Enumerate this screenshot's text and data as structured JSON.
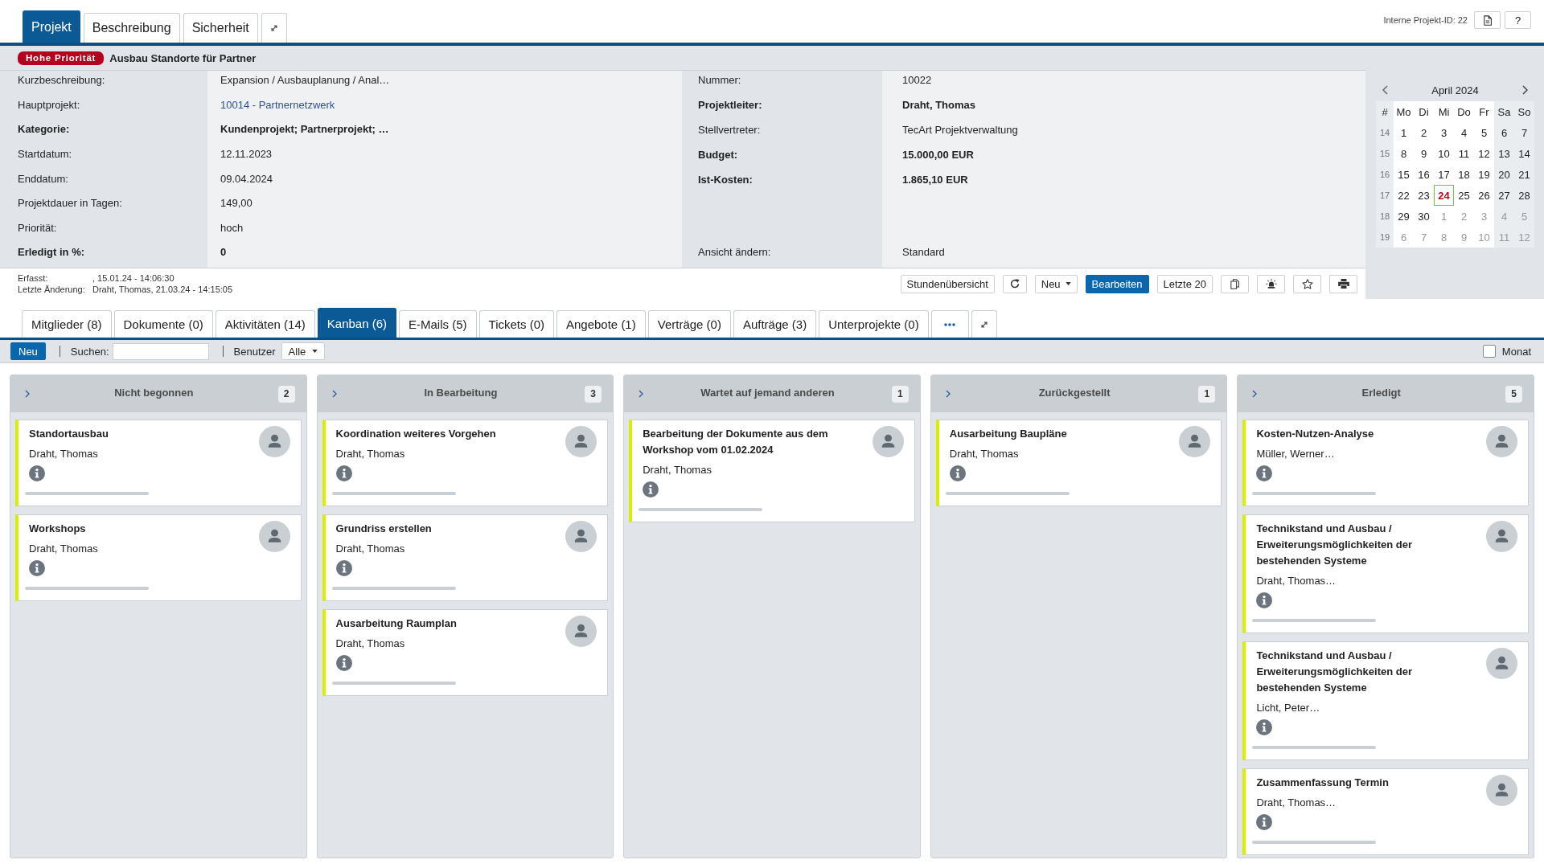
{
  "top_tabs": [
    {
      "label": "Projekt",
      "selected": true
    },
    {
      "label": "Beschreibung",
      "selected": false
    },
    {
      "label": "Sicherheit",
      "selected": false
    }
  ],
  "header": {
    "project_id": "Interne Projekt-ID: 22",
    "help_button": "?"
  },
  "project": {
    "priority": "Hohe Priorität",
    "title": "Ausbau Standorte für Partner"
  },
  "details_left": [
    {
      "kind": "text",
      "label": "Kurzbeschreibung:",
      "value": "Expansion / Ausbauplanung / Anal…",
      "bold": false
    },
    {
      "kind": "link",
      "label": "Hauptprojekt:",
      "value": "10014 - Partnernetzwerk",
      "bold": false
    },
    {
      "kind": "text",
      "label": "Kategorie:",
      "value": "Kundenprojekt; Partnerprojekt; …",
      "bold": true
    },
    {
      "kind": "text",
      "label": "Startdatum:",
      "value": "12.11.2023",
      "bold": false
    },
    {
      "kind": "text",
      "label": "Enddatum:",
      "value": "09.04.2024",
      "bold": false
    },
    {
      "kind": "text",
      "label": "Projektdauer in Tagen:",
      "value": "149,00",
      "bold": false
    },
    {
      "kind": "text",
      "label": "Priorität:",
      "value": "hoch",
      "bold": false
    },
    {
      "kind": "text",
      "label": "Erledigt in %:",
      "value": "0",
      "bold": true
    }
  ],
  "details_right": [
    {
      "label": "Nummer:",
      "value": "10022",
      "bold": false
    },
    {
      "label": "Projektleiter:",
      "value": "Draht, Thomas",
      "bold": true
    },
    {
      "label": "Stellvertreter:",
      "value": "TecArt Projektverwaltung",
      "bold": false
    },
    {
      "label": "Budget:",
      "value": "15.000,00 EUR",
      "bold": true
    },
    {
      "label": "Ist-Kosten:",
      "value": "1.865,10 EUR",
      "bold": true
    }
  ],
  "view_setting": {
    "label": "Ansicht ändern:",
    "value": "Standard"
  },
  "record_info": {
    "created_label": "Erfasst:",
    "created_value": ", 15.01.24 - 14:06:30",
    "changed_label": "Letzte Änderung:",
    "changed_value": "Draht, Thomas, 21.03.24 - 14:15:05"
  },
  "actions": {
    "hours_button": "Stundenübersicht",
    "new_menu": "Neu",
    "edit_button": "Bearbeiten",
    "recent_button": "Letzte 20"
  },
  "calendar": {
    "month": "April 2024",
    "week_header": "#",
    "weekdays": [
      "Mo",
      "Di",
      "Mi",
      "Do",
      "Fr",
      "Sa",
      "So"
    ],
    "weeks": [
      {
        "number": "14",
        "days": [
          {
            "day": "1",
            "outside": false,
            "today": false
          },
          {
            "day": "2",
            "outside": false,
            "today": false
          },
          {
            "day": "3",
            "outside": false,
            "today": false
          },
          {
            "day": "4",
            "outside": false,
            "today": false
          },
          {
            "day": "5",
            "outside": false,
            "today": false
          },
          {
            "day": "6",
            "outside": false,
            "today": false
          },
          {
            "day": "7",
            "outside": false,
            "today": false
          }
        ]
      },
      {
        "number": "15",
        "days": [
          {
            "day": "8",
            "outside": false,
            "today": false
          },
          {
            "day": "9",
            "outside": false,
            "today": false
          },
          {
            "day": "10",
            "outside": false,
            "today": false
          },
          {
            "day": "11",
            "outside": false,
            "today": false
          },
          {
            "day": "12",
            "outside": false,
            "today": false
          },
          {
            "day": "13",
            "outside": false,
            "today": false
          },
          {
            "day": "14",
            "outside": false,
            "today": false
          }
        ]
      },
      {
        "number": "16",
        "days": [
          {
            "day": "15",
            "outside": false,
            "today": false
          },
          {
            "day": "16",
            "outside": false,
            "today": false
          },
          {
            "day": "17",
            "outside": false,
            "today": false
          },
          {
            "day": "18",
            "outside": false,
            "today": false
          },
          {
            "day": "19",
            "outside": false,
            "today": false
          },
          {
            "day": "20",
            "outside": false,
            "today": false
          },
          {
            "day": "21",
            "outside": false,
            "today": false
          }
        ]
      },
      {
        "number": "17",
        "days": [
          {
            "day": "22",
            "outside": false,
            "today": false
          },
          {
            "day": "23",
            "outside": false,
            "today": false
          },
          {
            "day": "24",
            "outside": false,
            "today": true
          },
          {
            "day": "25",
            "outside": false,
            "today": false
          },
          {
            "day": "26",
            "outside": false,
            "today": false
          },
          {
            "day": "27",
            "outside": false,
            "today": false
          },
          {
            "day": "28",
            "outside": false,
            "today": false
          }
        ]
      },
      {
        "number": "18",
        "days": [
          {
            "day": "29",
            "outside": false,
            "today": false
          },
          {
            "day": "30",
            "outside": false,
            "today": false
          },
          {
            "day": "1",
            "outside": true,
            "today": false
          },
          {
            "day": "2",
            "outside": true,
            "today": false
          },
          {
            "day": "3",
            "outside": true,
            "today": false
          },
          {
            "day": "4",
            "outside": true,
            "today": false
          },
          {
            "day": "5",
            "outside": true,
            "today": false
          }
        ]
      },
      {
        "number": "19",
        "days": [
          {
            "day": "6",
            "outside": true,
            "today": false
          },
          {
            "day": "7",
            "outside": true,
            "today": false
          },
          {
            "day": "8",
            "outside": true,
            "today": false
          },
          {
            "day": "9",
            "outside": true,
            "today": false
          },
          {
            "day": "10",
            "outside": true,
            "today": false
          },
          {
            "day": "11",
            "outside": true,
            "today": false
          },
          {
            "day": "12",
            "outside": true,
            "today": false
          }
        ]
      }
    ]
  },
  "detail_tabs": [
    {
      "label": "Mitglieder (8)",
      "selected": false
    },
    {
      "label": "Dokumente (0)",
      "selected": false
    },
    {
      "label": "Aktivitäten (14)",
      "selected": false
    },
    {
      "label": "Kanban (6)",
      "selected": true
    },
    {
      "label": "E-Mails (5)",
      "selected": false
    },
    {
      "label": "Tickets (0)",
      "selected": false
    },
    {
      "label": "Angebote (1)",
      "selected": false
    },
    {
      "label": "Verträge (0)",
      "selected": false
    },
    {
      "label": "Aufträge (3)",
      "selected": false
    },
    {
      "label": "Unterprojekte (0)",
      "selected": false
    }
  ],
  "toolbar": {
    "new_button": "Neu",
    "search_label": "Suchen:",
    "user_label": "Benutzer",
    "user_filter": "Alle",
    "month_label": "Monat",
    "month_checked": false
  },
  "kanban": {
    "columns": [
      {
        "title": "Nicht begonnen",
        "count": "2",
        "cards": [
          {
            "title": "Standortausbau",
            "assignee": "Draht, Thomas"
          },
          {
            "title": "Workshops",
            "assignee": "Draht, Thomas"
          }
        ]
      },
      {
        "title": "In Bearbeitung",
        "count": "3",
        "cards": [
          {
            "title": "Koordination weiteres Vorgehen",
            "assignee": "Draht, Thomas"
          },
          {
            "title": "Grundriss erstellen",
            "assignee": "Draht, Thomas"
          },
          {
            "title": "Ausarbeitung Raumplan",
            "assignee": "Draht, Thomas"
          }
        ]
      },
      {
        "title": "Wartet auf jemand anderen",
        "count": "1",
        "cards": [
          {
            "title": "Bearbeitung der Dokumente aus dem Workshop vom 01.02.2024",
            "assignee": "Draht, Thomas"
          }
        ]
      },
      {
        "title": "Zurückgestellt",
        "count": "1",
        "cards": [
          {
            "title": "Ausarbeitung Baupläne",
            "assignee": "Draht, Thomas"
          }
        ]
      },
      {
        "title": "Erledigt",
        "count": "5",
        "cards": [
          {
            "title": "Kosten-Nutzen-Analyse",
            "assignee": "Müller, Werner…"
          },
          {
            "title": "Technikstand und Ausbau / Erweiterungsmöglichkeiten der bestehenden Systeme",
            "assignee": "Draht, Thomas…"
          },
          {
            "title": "Technikstand und Ausbau / Erweiterungsmöglichkeiten der bestehenden Systeme",
            "assignee": "Licht, Peter…"
          },
          {
            "title": "Zusammenfassung Termin",
            "assignee": "Draht, Thomas…"
          }
        ]
      }
    ]
  }
}
